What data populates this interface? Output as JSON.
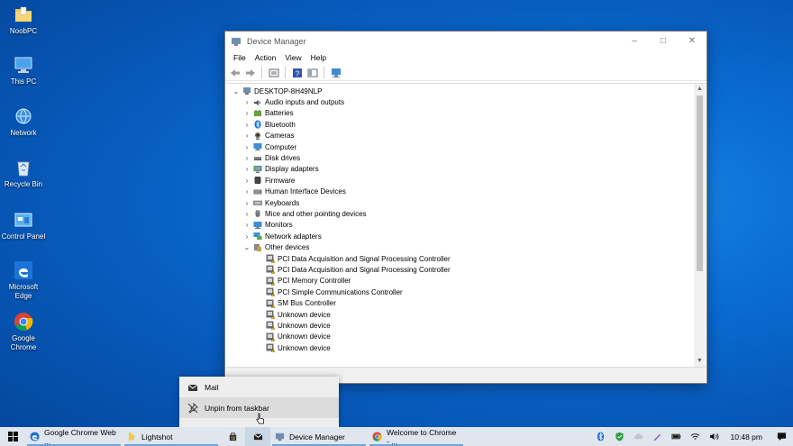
{
  "desktop": {
    "icons": [
      {
        "label": "NoobPC",
        "icon": "folder-icon"
      },
      {
        "label": "This PC",
        "icon": "computer-icon"
      },
      {
        "label": "Network",
        "icon": "network-icon"
      },
      {
        "label": "Recycle Bin",
        "icon": "recycle-bin-icon"
      },
      {
        "label": "Control Panel",
        "icon": "control-panel-icon"
      },
      {
        "label": "Microsoft Edge",
        "icon": "edge-icon"
      },
      {
        "label": "Google Chrome",
        "icon": "chrome-icon"
      }
    ]
  },
  "window": {
    "title": "Device Manager",
    "menu": [
      "File",
      "Action",
      "View",
      "Help"
    ],
    "root": "DESKTOP-8H49NLP",
    "categories": [
      {
        "label": "Audio inputs and outputs",
        "icon": "audio-icon"
      },
      {
        "label": "Batteries",
        "icon": "battery-icon"
      },
      {
        "label": "Bluetooth",
        "icon": "bluetooth-icon"
      },
      {
        "label": "Cameras",
        "icon": "camera-icon"
      },
      {
        "label": "Computer",
        "icon": "monitor-icon"
      },
      {
        "label": "Disk drives",
        "icon": "disk-icon"
      },
      {
        "label": "Display adapters",
        "icon": "display-adapter-icon"
      },
      {
        "label": "Firmware",
        "icon": "firmware-icon"
      },
      {
        "label": "Human Interface Devices",
        "icon": "hid-icon"
      },
      {
        "label": "Keyboards",
        "icon": "keyboard-icon"
      },
      {
        "label": "Mice and other pointing devices",
        "icon": "mouse-icon"
      },
      {
        "label": "Monitors",
        "icon": "monitor-icon"
      },
      {
        "label": "Network adapters",
        "icon": "network-adapter-icon"
      },
      {
        "label": "Other devices",
        "icon": "other-devices-icon",
        "expanded": true
      }
    ],
    "other_devices": [
      "PCI Data Acquisition and Signal Processing Controller",
      "PCI Data Acquisition and Signal Processing Controller",
      "PCI Memory Controller",
      "PCI Simple Communications Controller",
      "SM Bus Controller",
      "Unknown device",
      "Unknown device",
      "Unknown device",
      "Unknown device"
    ]
  },
  "jumplist": {
    "items": [
      {
        "label": "Mail",
        "icon": "mail-icon"
      },
      {
        "label": "Unpin from taskbar",
        "icon": "unpin-icon"
      }
    ]
  },
  "taskbar": {
    "tasks": [
      {
        "label": "Google Chrome Web ...",
        "icon": "edge-icon"
      },
      {
        "label": "Lightshot",
        "icon": "lightshot-icon"
      },
      {
        "label": "",
        "icon": "store-icon"
      },
      {
        "label": "",
        "icon": "mail-icon"
      },
      {
        "label": "Device Manager",
        "icon": "device-manager-icon"
      },
      {
        "label": "Welcome to Chrome - ...",
        "icon": "chrome-icon"
      }
    ],
    "clock": "10:48 pm"
  },
  "colors": {
    "accent": "#0a6fd6",
    "taskbar": "#dfe6ee",
    "warning": "#e8b400"
  }
}
